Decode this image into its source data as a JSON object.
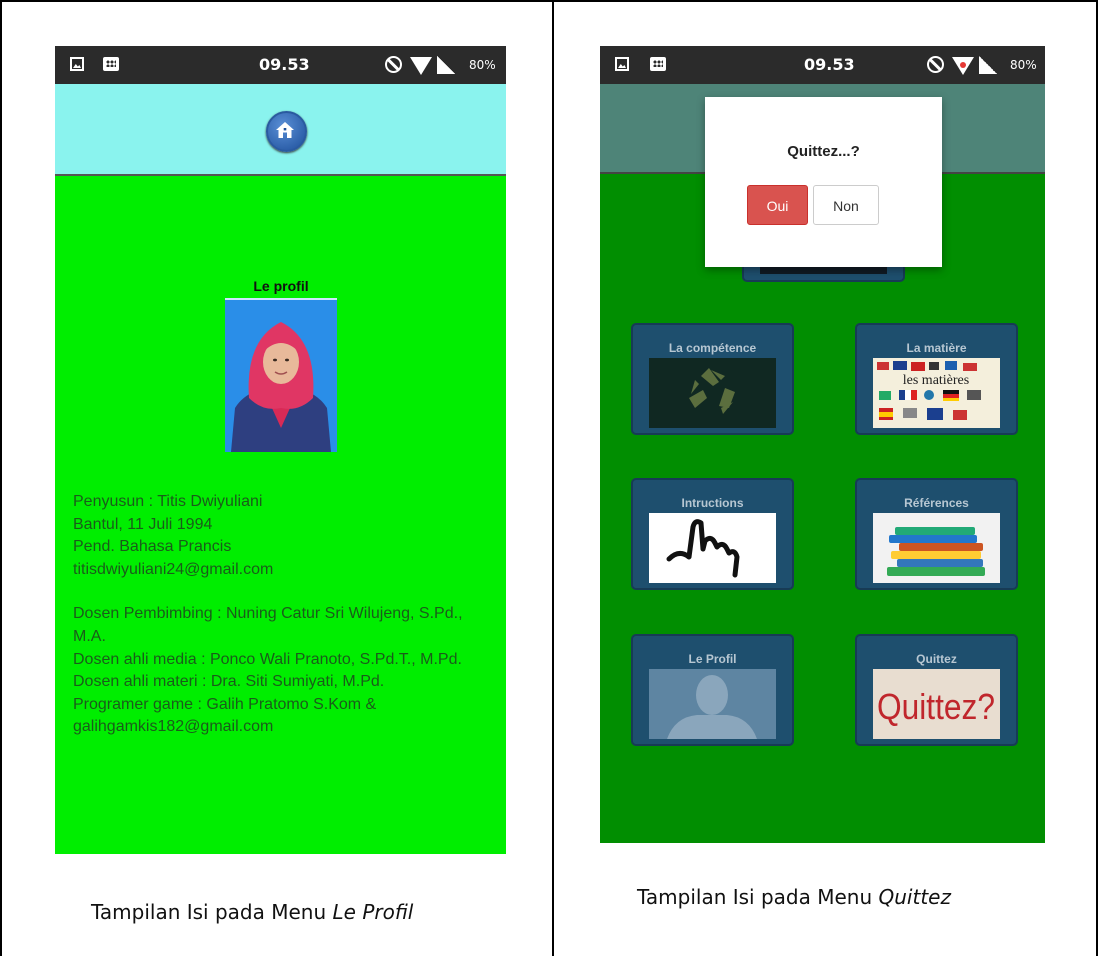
{
  "left_panel": {
    "status": {
      "time": "09.53",
      "battery": "80%"
    },
    "profile": {
      "title": "Le profil",
      "lines1": [
        "Penyusun : Titis Dwiyuliani",
        "Bantul, 11 Juli 1994",
        "Pend. Bahasa Prancis",
        "titisdwiyuliani24@gmail.com"
      ],
      "lines2": [
        "Dosen Pembimbing : Nuning Catur Sri Wilujeng, S.Pd.,",
        "M.A.",
        "Dosen ahli media : Ponco Wali Pranoto, S.Pd.T., M.Pd.",
        "Dosen ahli materi : Dra. Siti Sumiyati, M.Pd.",
        "Programer game : Galih Pratomo S.Kom &",
        "galihgamkis182@gmail.com"
      ]
    },
    "caption_prefix": "Tampilan Isi pada Menu ",
    "caption_italic": "Le Profil"
  },
  "right_panel": {
    "status": {
      "time": "09.53",
      "battery": "80%"
    },
    "dialog": {
      "question": "Quittez...?",
      "yes_label": "Oui",
      "no_label": "Non"
    },
    "menu": [
      {
        "label": "La compétence",
        "icon": "recycle-icon"
      },
      {
        "label": "La matière",
        "icon": "flags-icon"
      },
      {
        "label": "Intructions",
        "icon": "hand-pointer-icon"
      },
      {
        "label": "Références",
        "icon": "books-icon"
      },
      {
        "label": "Le Profil",
        "icon": "person-silhouette-icon"
      },
      {
        "label": "Quittez",
        "icon": "quittez-icon"
      }
    ],
    "matiere_image_text": "les matières",
    "quittez_image_text": "Quittez?",
    "caption_prefix": "Tampilan Isi pada Menu ",
    "caption_italic": "Quittez"
  },
  "colors": {
    "profile_bg": "#00ee00",
    "left_header": "#8af3ee",
    "menu_bg": "#018e01",
    "oui": "#d9534f"
  }
}
